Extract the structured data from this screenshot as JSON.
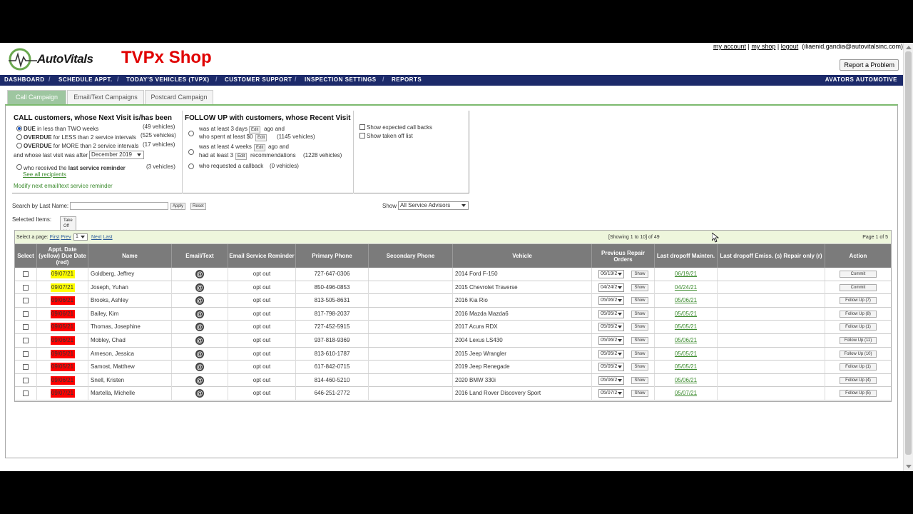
{
  "header": {
    "logo_text": "AutoVitals",
    "shop_title": "TVPx Shop",
    "links": [
      "my account",
      "my shop",
      "logout"
    ],
    "user_email": "(iliaenid.gandia@autovitalsinc.com)",
    "report_button": "Report a Problem"
  },
  "navbar": {
    "items": [
      "DASHBOARD",
      "SCHEDULE APPT.",
      "TODAY'S VEHICLES (TVPX)",
      "CUSTOMER SUPPORT",
      "INSPECTION SETTINGS",
      "REPORTS"
    ],
    "brand": "AVATORS AUTOMOTIVE"
  },
  "tabs": [
    "Call Campaign",
    "Email/Text Campaigns",
    "Postcard Campaign"
  ],
  "call": {
    "heading": "CALL customers, whose Next Visit is/has been",
    "opt1_bold": "DUE",
    "opt1_rest": "in less than TWO weeks",
    "opt1_count": "(49 vehicles)",
    "opt2_bold": "OVERDUE",
    "opt2_rest": "for LESS than 2 service intervals",
    "opt2_count": "(525 vehicles)",
    "opt3_bold": "OVERDUE",
    "opt3_rest": "for MORE than 2 service intervals",
    "opt3_count": "(17 vehicles)",
    "last_visit_label": "and whose last visit was after",
    "last_visit_value": "December 2019",
    "opt4_text": "who received the",
    "opt4_bold": "last service reminder",
    "opt4_count": "(3 vehicles)",
    "see_all": "See all recipients",
    "modify": "Modify next email/text service reminder"
  },
  "followup": {
    "heading": "FOLLOW UP with customers, whose Recent Visit",
    "r1_a": "was at least 3 days",
    "r1_b": "ago and",
    "r1_c": "who spent at least $0",
    "r1_count": "(1145 vehicles)",
    "r2_a": "was at least 4 weeks",
    "r2_b": "ago and",
    "r2_c": "had at least 3",
    "r2_d": "recommendations",
    "r2_count": "(1228 vehicles)",
    "r3_a": "who requested a callback",
    "r3_count": "(0 vehicles)",
    "edit": "Edit"
  },
  "options": {
    "show_expected": "Show expected call backs",
    "show_taken": "Show taken off list"
  },
  "search": {
    "label": "Search by Last Name:",
    "value": "",
    "apply": "Apply",
    "reset": "Reset",
    "show_label": "Show",
    "advisor": "All Service Advisors",
    "selected_items": "Selected Items:",
    "take_off": "Take Off List"
  },
  "pager": {
    "select_label": "Select a page:",
    "first": "First",
    "prev": "Prev",
    "page": "1",
    "next": "Next",
    "last": "Last",
    "showing": "[Showing 1 to 10] of 49",
    "page_of": "Page 1 of 5"
  },
  "columns": [
    "Select",
    "Appt. Date (yellow) Due Date (red)",
    "Name",
    "Email/Text",
    "Email Service Reminder",
    "Primary Phone",
    "Secondary Phone",
    "Vehicle",
    "Previous Repair Orders",
    "Last dropoff Mainten.",
    "Last dropoff Emiss. (s) Repair only (r)",
    "Action"
  ],
  "show_btn": "Show",
  "rows": [
    {
      "date": "09/07/21",
      "color": "#ffff00",
      "name": "Goldberg, Jeffrey",
      "reminder": "opt out",
      "phone": "727-647-0306",
      "vehicle": "2014 Ford F-150",
      "ro": "06/19/2",
      "last": "06/19/21",
      "action": "Commit"
    },
    {
      "date": "09/07/21",
      "color": "#ffff00",
      "name": "Joseph, Yuhan",
      "reminder": "opt out",
      "phone": "850-496-0853",
      "vehicle": "2015 Chevrolet Traverse",
      "ro": "04/24/2",
      "last": "04/24/21",
      "action": "Commit"
    },
    {
      "date": "09/06/21",
      "color": "#ff0000",
      "name": "Brooks, Ashley",
      "reminder": "opt out",
      "phone": "813-505-8631",
      "vehicle": "2016 Kia Rio",
      "ro": "05/06/2",
      "last": "05/06/21",
      "action": "Follow Up (7)"
    },
    {
      "date": "09/06/21",
      "color": "#ff0000",
      "name": "Bailey, Kim",
      "reminder": "opt out",
      "phone": "817-798-2037",
      "vehicle": "2016 Mazda Mazda6",
      "ro": "05/05/2",
      "last": "05/05/21",
      "action": "Follow Up (8)"
    },
    {
      "date": "09/05/21",
      "color": "#ff0000",
      "name": "Thomas, Josephine",
      "reminder": "opt out",
      "phone": "727-452-5915",
      "vehicle": "2017 Acura RDX",
      "ro": "05/05/2",
      "last": "05/05/21",
      "action": "Follow Up (1)"
    },
    {
      "date": "09/06/21",
      "color": "#ff0000",
      "name": "Mobley, Chad",
      "reminder": "opt out",
      "phone": "937-818-9369",
      "vehicle": "2004 Lexus LS430",
      "ro": "05/06/2",
      "last": "05/06/21",
      "action": "Follow Up (11)"
    },
    {
      "date": "09/05/21",
      "color": "#ff0000",
      "name": "Arneson, Jessica",
      "reminder": "opt out",
      "phone": "813-610-1787",
      "vehicle": "2015 Jeep Wrangler",
      "ro": "05/05/2",
      "last": "05/05/21",
      "action": "Follow Up (10)"
    },
    {
      "date": "09/05/21",
      "color": "#ff0000",
      "name": "Samost, Matthew",
      "reminder": "opt out",
      "phone": "617-842-0715",
      "vehicle": "2019 Jeep Renegade",
      "ro": "05/05/2",
      "last": "05/05/21",
      "action": "Follow Up (1)"
    },
    {
      "date": "09/06/21",
      "color": "#ff0000",
      "name": "Snell, Kristen",
      "reminder": "opt out",
      "phone": "814-460-5210",
      "vehicle": "2020 BMW 330i",
      "ro": "05/06/2",
      "last": "05/06/21",
      "action": "Follow Up (4)"
    },
    {
      "date": "09/07/21",
      "color": "#ff0000",
      "name": "Martella, Michelle",
      "reminder": "opt out",
      "phone": "646-251-2772",
      "vehicle": "2016 Land Rover Discovery Sport",
      "ro": "05/07/2",
      "last": "05/07/21",
      "action": "Follow Up (5)"
    }
  ]
}
